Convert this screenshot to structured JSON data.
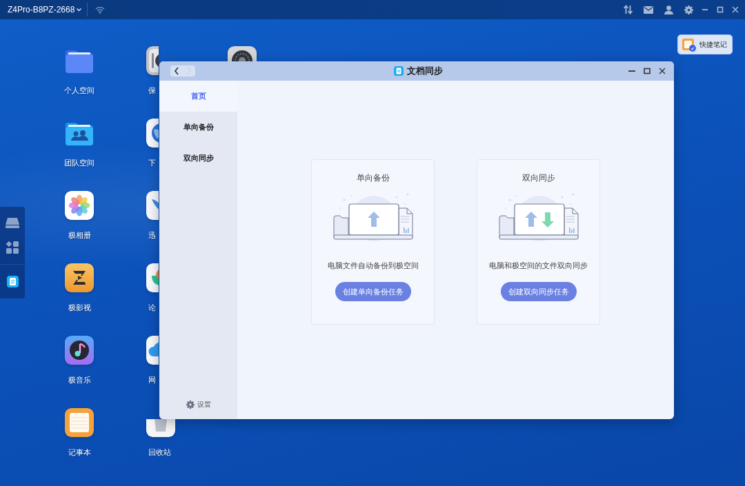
{
  "top_bar": {
    "device_name": "Z4Pro-B8PZ-2668"
  },
  "desktop_icons": [
    {
      "label": "个人空间",
      "kind": "folder"
    },
    {
      "label": "团队空间",
      "kind": "team"
    },
    {
      "label": "极相册",
      "kind": "photos"
    },
    {
      "label": "极影视",
      "kind": "video"
    },
    {
      "label": "极音乐",
      "kind": "music"
    },
    {
      "label": "记事本",
      "kind": "notes"
    },
    {
      "label": "保",
      "kind": "safe"
    },
    {
      "label": "下",
      "kind": "globe"
    },
    {
      "label": "迅",
      "kind": "bird"
    },
    {
      "label": "论",
      "kind": "chat"
    },
    {
      "label": "网",
      "kind": "cloud"
    },
    {
      "label": "回收站",
      "kind": "trash"
    },
    {
      "kind": "settings"
    }
  ],
  "quick_note": {
    "label": "快捷笔记"
  },
  "window": {
    "title": "文档同步",
    "nav_buttons": [
      {
        "kind": "back",
        "disabled": false
      },
      {
        "kind": "forward",
        "disabled": true
      }
    ]
  },
  "sidebar": {
    "items": [
      {
        "label": "首页",
        "selected": true
      },
      {
        "label": "单向备份",
        "selected": false
      },
      {
        "label": "双向同步",
        "selected": false
      }
    ],
    "settings_label": "设置"
  },
  "cards": [
    {
      "kind": "one_way",
      "title": "单向备份",
      "description": "电脑文件自动备份到极空间",
      "button": "创建单向备份任务"
    },
    {
      "kind": "two_way",
      "title": "双向同步",
      "description": "电脑和极空间的文件双向同步",
      "button": "创建双向同步任务"
    }
  ]
}
